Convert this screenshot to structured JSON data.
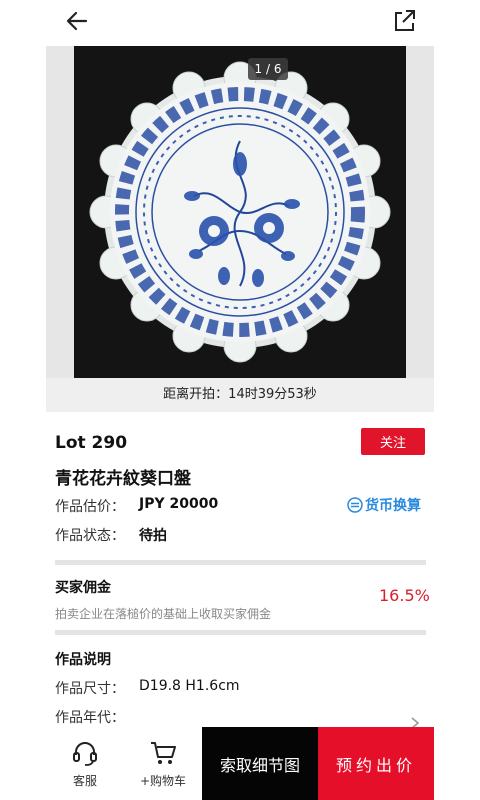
{
  "gallery": {
    "counter": "1 / 6"
  },
  "countdown": {
    "text": "距离开拍：14时39分53秒"
  },
  "lot": {
    "number": "Lot 290",
    "follow_label": "关注",
    "title": "青花花卉紋葵口盤"
  },
  "estimate": {
    "label": "作品估价：",
    "value": "JPY 20000",
    "currency_label": "货币换算"
  },
  "status": {
    "label": "作品状态：",
    "value": "待拍"
  },
  "commission": {
    "title": "买家佣金",
    "description": "拍卖企业在落槌价的基础上收取买家佣金",
    "rate": "16.5%"
  },
  "description": {
    "title": "作品说明",
    "size_label": "作品尺寸：",
    "size_value": "D19.8 H1.6cm",
    "era_label": "作品年代："
  },
  "bottom": {
    "service_label": "客服",
    "cart_label": "+购物车",
    "detail_label": "索取细节图",
    "bid_label": "预约出价"
  },
  "colors": {
    "accent_red": "#e0142a",
    "link_blue": "#2a8adf",
    "rate_red": "#d81e2c"
  },
  "icons": [
    "back-arrow-icon",
    "share-icon",
    "currency-exchange-icon",
    "headset-icon",
    "cart-icon",
    "chevron-right-icon"
  ]
}
